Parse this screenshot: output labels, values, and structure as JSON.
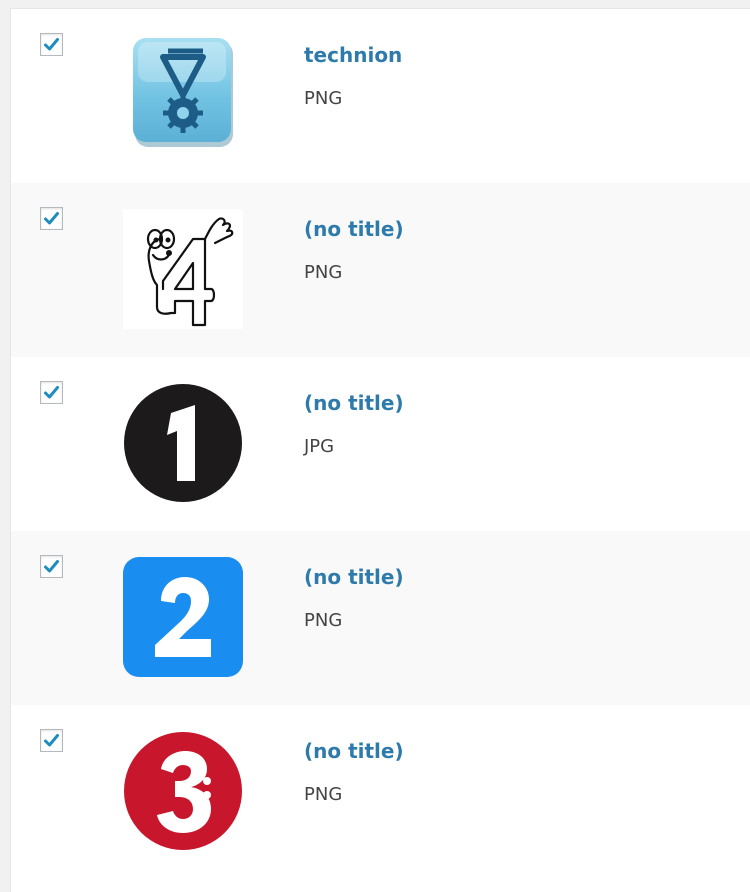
{
  "media_list": {
    "items": [
      {
        "title": "technion",
        "file_type": "PNG",
        "checked": true,
        "thumbnail": "technion-logo"
      },
      {
        "title": "(no title)",
        "file_type": "PNG",
        "checked": true,
        "thumbnail": "cartoon-four-character"
      },
      {
        "title": "(no title)",
        "file_type": "JPG",
        "checked": true,
        "thumbnail": "black-circle-number-1"
      },
      {
        "title": "(no title)",
        "file_type": "PNG",
        "checked": true,
        "thumbnail": "blue-square-number-2"
      },
      {
        "title": "(no title)",
        "file_type": "PNG",
        "checked": true,
        "thumbnail": "red-circle-number-3"
      }
    ]
  },
  "colors": {
    "title_link": "#2e7bab",
    "checkmark": "#1e8cbe",
    "row_alt": "#f9f9f9"
  }
}
